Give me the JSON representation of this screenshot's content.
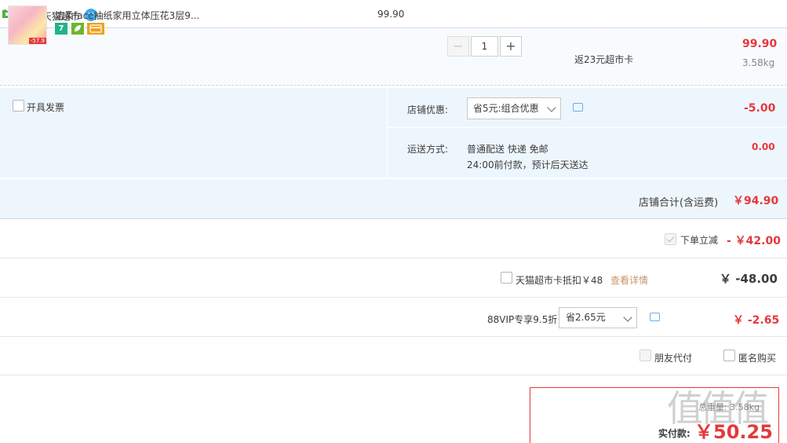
{
  "shop": {
    "label": "店铺: 天猫超市",
    "wangwang_badge": "11"
  },
  "item": {
    "title": "洁柔face抽纸家用立体压花3层9...",
    "thumb_tag": "-57.9",
    "badges": {
      "seven": "7"
    },
    "unit_price": "99.90",
    "quantity": "1",
    "qty_minus": "−",
    "qty_plus": "+",
    "rebate": "返23元超市卡",
    "total": "99.90",
    "weight": "3.58kg"
  },
  "options": {
    "invoice_label": "开具发票",
    "shop_coupon_label": "店铺优惠:",
    "shop_coupon_selected": "省5元:组合优惠",
    "shop_coupon_amount": "-5.00",
    "shipping_label": "运送方式:",
    "shipping_method": "普通配送 快递 免邮",
    "shipping_time": "24:00前付款，预计后天送达",
    "shipping_fee": "0.00"
  },
  "subtotal": {
    "label": "店铺合计(含运费)",
    "amount": "￥94.90"
  },
  "discount": {
    "label": "下单立减",
    "amount": "- ￥42.00"
  },
  "supermarket_card": {
    "label": "天猫超市卡抵扣￥48",
    "detail_link": "查看详情",
    "amount": "￥ -48.00"
  },
  "vip": {
    "label": "88VIP专享9.5折",
    "selected": "省2.65元",
    "amount": "￥ -2.65"
  },
  "extras": {
    "friend_pay": "朋友代付",
    "anonymous": "匿名购买"
  },
  "final": {
    "weight_text": "总重量: 3.58kg",
    "label": "实付款:",
    "amount": "￥50.25"
  },
  "colors": {
    "accent_red": "#e4393c",
    "panel_blue": "#eef6fd",
    "link_tan": "#c9946a"
  }
}
